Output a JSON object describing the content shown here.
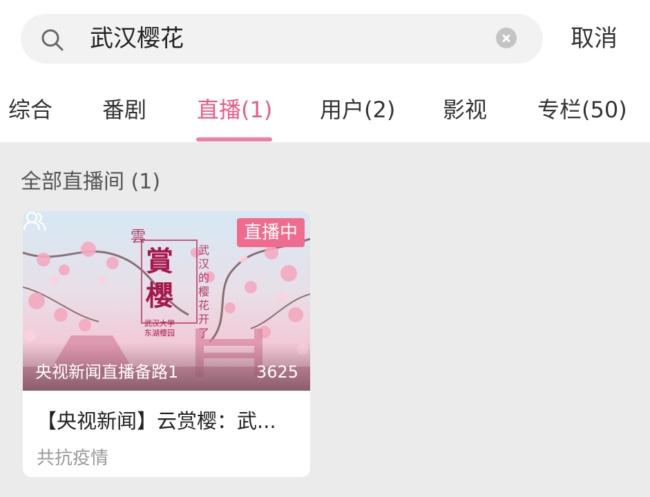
{
  "search": {
    "query": "武汉樱花",
    "cancel_label": "取消"
  },
  "tabs": [
    {
      "label": "综合",
      "active": false
    },
    {
      "label": "番剧",
      "active": false
    },
    {
      "label": "直播(1)",
      "active": true
    },
    {
      "label": "用户(2)",
      "active": false
    },
    {
      "label": "影视",
      "active": false
    },
    {
      "label": "专栏(50)",
      "active": false
    }
  ],
  "section": {
    "title": "全部直播间 (1)"
  },
  "card": {
    "live_badge": "直播中",
    "room_name": "央视新闻直播备路1",
    "viewers": "3625",
    "title": "【央视新闻】云赏樱：武...",
    "tag": "共抗疫情",
    "poster_text": {
      "cloud": "雲",
      "main": "賞櫻",
      "subtitle": "武汉的樱花开了",
      "place": "武汉大学 东湖樱园"
    }
  },
  "colors": {
    "accent": "#e85a86",
    "badge": "#f06b8e",
    "background": "#ebebeb"
  },
  "icons": [
    "search-icon",
    "clear-icon",
    "viewers-icon"
  ]
}
